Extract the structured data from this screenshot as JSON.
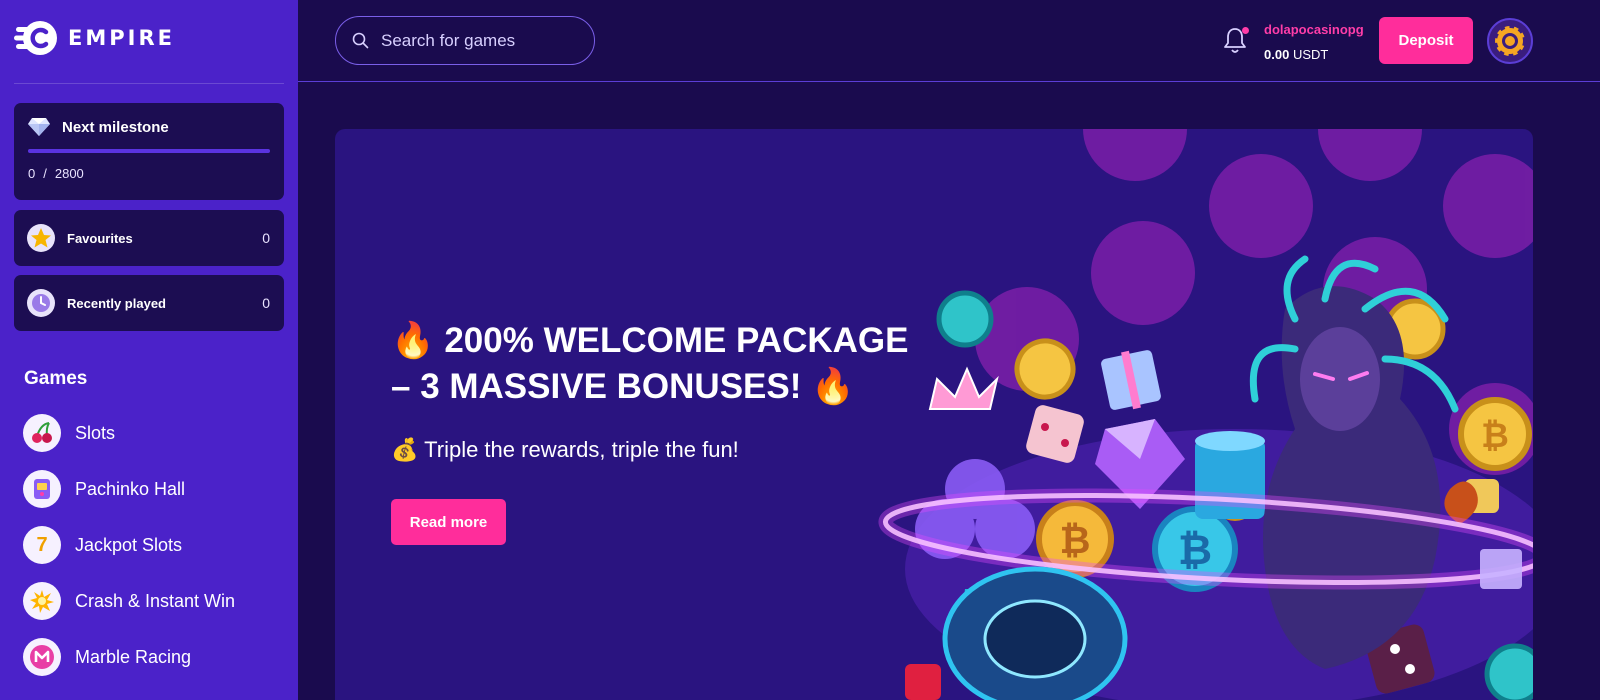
{
  "brand": {
    "name": "EMPIRE"
  },
  "sidebar": {
    "milestone": {
      "title": "Next milestone",
      "current": "0",
      "separator": "/",
      "target": "2800",
      "progress": 0
    },
    "favourites": {
      "label": "Favourites",
      "count": "0"
    },
    "recent": {
      "label": "Recently played",
      "count": "0"
    },
    "games_heading": "Games",
    "games": [
      {
        "label": "Slots",
        "icon": "cherries-icon"
      },
      {
        "label": "Pachinko Hall",
        "icon": "pachinko-icon"
      },
      {
        "label": "Jackpot Slots",
        "icon": "seven-icon"
      },
      {
        "label": "Crash & Instant Win",
        "icon": "explosion-icon"
      },
      {
        "label": "Marble Racing",
        "icon": "marble-m-icon"
      }
    ]
  },
  "header": {
    "search_placeholder": "Search for games",
    "username": "dolapocasinopg",
    "balance_amount": "0.00",
    "balance_currency": "USDT",
    "deposit_label": "Deposit"
  },
  "banner": {
    "title_emoji": "🔥",
    "title": "200% WELCOME PACKAGE – 3 MASSIVE BONUSES!",
    "sub_emoji": "💰",
    "subtitle": "Triple the rewards, triple the fun!",
    "cta_label": "Read more"
  },
  "colors": {
    "sidebar": "#4b22c9",
    "background": "#1a0b4e",
    "accent": "#ff2d9b",
    "banner": "#2a1480"
  }
}
